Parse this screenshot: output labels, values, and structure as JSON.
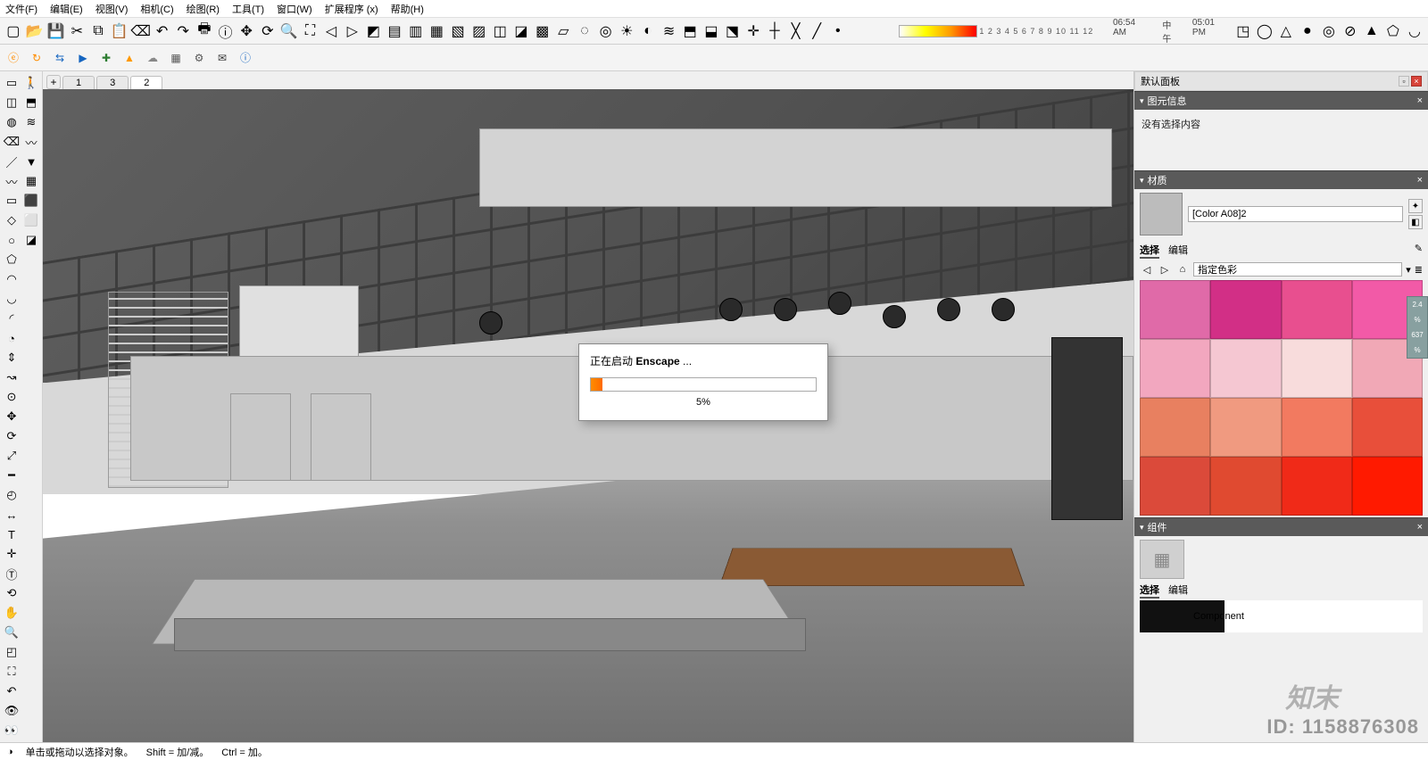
{
  "menu": [
    "文件(F)",
    "编辑(E)",
    "视图(V)",
    "相机(C)",
    "绘图(R)",
    "工具(T)",
    "窗口(W)",
    "扩展程序 (x)",
    "帮助(H)"
  ],
  "toolbar_icons": [
    "new",
    "open",
    "save",
    "cut",
    "copy",
    "paste",
    "erase",
    "undo",
    "redo",
    "print",
    "model-info",
    "pan",
    "orbit",
    "zoom",
    "zoom-extents",
    "prev",
    "next",
    "iso",
    "top",
    "front",
    "right",
    "back",
    "left",
    "xray",
    "shaded",
    "shaded-tex",
    "wire",
    "hidden",
    "mono",
    "sun",
    "shadows",
    "fog",
    "section",
    "sec-fill",
    "sec-cut",
    "axes",
    "guides",
    "hidden-geom",
    "back-edges",
    "endpoints"
  ],
  "toolbar_numbers": "1 2 3 4 5 6 7 8 9 10 11 12",
  "times": {
    "am": "06:54 AM",
    "noon": "中午",
    "pm": "05:01 PM"
  },
  "shape_icons": [
    "box",
    "cyl",
    "cone",
    "sphere",
    "torus",
    "tube",
    "pyr",
    "prism",
    "dome"
  ],
  "plugin_icons": [
    "enscape",
    "refresh",
    "sync",
    "live",
    "layers-add",
    "terrain",
    "cloud",
    "render",
    "settings",
    "mail",
    "info"
  ],
  "left_tools": [
    "select",
    "component",
    "paint",
    "eraser",
    "line",
    "freehand",
    "rect",
    "rotated-rect",
    "circle",
    "polygon",
    "arc",
    "2pt-arc",
    "3pt-arc",
    "pie",
    "pushpull",
    "follow",
    "offset",
    "move",
    "rotate",
    "scale",
    "tape",
    "protractor",
    "dimension",
    "text",
    "axes",
    "3dtext",
    "orbit",
    "pan",
    "zoom",
    "zoom-window",
    "zoom-extents",
    "prev",
    "position-cam",
    "look",
    "walk",
    "section",
    "sandbox1",
    "sandbox2",
    "drape",
    "grid",
    "solid1",
    "solid2",
    "solid3"
  ],
  "scene_tabs": [
    {
      "label": "1",
      "active": false
    },
    {
      "label": "3",
      "active": false
    },
    {
      "label": "2",
      "active": true
    }
  ],
  "scene_add": "+",
  "dialog": {
    "title_prefix": "正在启动 ",
    "title_bold": "Enscape",
    "title_suffix": " ...",
    "percent": "5%",
    "fill": 5
  },
  "tray": {
    "title": "默认面板",
    "entity_info": {
      "title": "图元信息",
      "msg": "没有选择内容"
    },
    "materials": {
      "title": "材质",
      "name": "[Color A08]2",
      "tab_select": "选择",
      "tab_edit": "编辑",
      "collection": "指定色彩",
      "swatches": [
        "#e06aa8",
        "#d22f86",
        "#e84f8f",
        "#f25aa7",
        "#f2a7bf",
        "#f5c7d2",
        "#f8dcdc",
        "#f1a8b6",
        "#e88060",
        "#f09a80",
        "#f27a60",
        "#e84f3a",
        "#db4a3a",
        "#e04a30",
        "#f02a18",
        "#ff1a00"
      ]
    },
    "components": {
      "title": "组件",
      "tab_select": "选择",
      "tab_edit": "编辑",
      "label": "Component"
    }
  },
  "mini_side": [
    "2.4",
    "%",
    "637",
    "%"
  ],
  "status": {
    "hint": "单击或拖动以选择对象。",
    "shift": "Shift = 加/减。",
    "ctrl": "Ctrl = 加。"
  },
  "watermark": {
    "id": "ID: 1158876308",
    "logo": "知末"
  },
  "pans": [
    {
      "left": "62%",
      "top": "32%"
    },
    {
      "left": "67%",
      "top": "32%"
    },
    {
      "left": "72%",
      "top": "31%"
    },
    {
      "left": "77%",
      "top": "33%"
    },
    {
      "left": "82%",
      "top": "32%"
    },
    {
      "left": "87%",
      "top": "32%"
    },
    {
      "left": "40%",
      "top": "34%"
    }
  ]
}
